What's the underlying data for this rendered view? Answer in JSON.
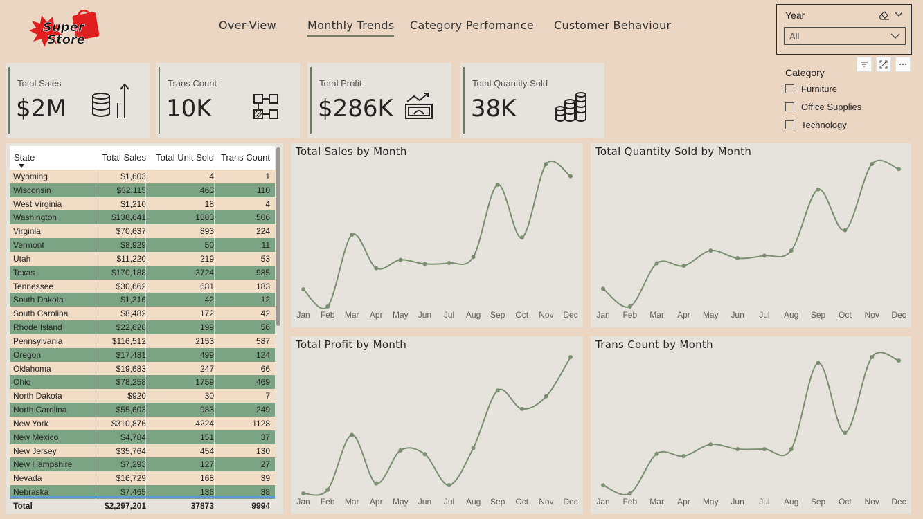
{
  "logo": {
    "line1": "Super",
    "line2": "Store"
  },
  "nav": {
    "tabs": [
      {
        "label": "Over-View"
      },
      {
        "label": "Monthly Trends",
        "active": true
      },
      {
        "label": "Category Perfomance"
      },
      {
        "label": "Customer Behaviour"
      }
    ]
  },
  "year_slicer": {
    "title": "Year",
    "selected": "All"
  },
  "kpis": [
    {
      "label": "Total Sales",
      "value": "$2M",
      "icon": "database-growth-icon"
    },
    {
      "label": "Trans Count",
      "value": "10K",
      "icon": "flowchart-icon"
    },
    {
      "label": "Total Profit",
      "value": "$286K",
      "icon": "profit-chart-icon"
    },
    {
      "label": "Total Quantity Sold",
      "value": "38K",
      "icon": "coin-stacks-icon"
    }
  ],
  "category_slicer": {
    "title": "Category",
    "items": [
      {
        "label": "Furniture",
        "checked": false
      },
      {
        "label": "Office Supplies",
        "checked": false
      },
      {
        "label": "Technology",
        "checked": false
      }
    ]
  },
  "table": {
    "headers": [
      "State",
      "Total Sales",
      "Total Unit Sold",
      "Trans Count"
    ],
    "rows": [
      [
        "Wyoming",
        "$1,603",
        "4",
        "1"
      ],
      [
        "Wisconsin",
        "$32,115",
        "463",
        "110"
      ],
      [
        "West Virginia",
        "$1,210",
        "18",
        "4"
      ],
      [
        "Washington",
        "$138,641",
        "1883",
        "506"
      ],
      [
        "Virginia",
        "$70,637",
        "893",
        "224"
      ],
      [
        "Vermont",
        "$8,929",
        "50",
        "11"
      ],
      [
        "Utah",
        "$11,220",
        "219",
        "53"
      ],
      [
        "Texas",
        "$170,188",
        "3724",
        "985"
      ],
      [
        "Tennessee",
        "$30,662",
        "681",
        "183"
      ],
      [
        "South Dakota",
        "$1,316",
        "42",
        "12"
      ],
      [
        "South Carolina",
        "$8,482",
        "172",
        "42"
      ],
      [
        "Rhode Island",
        "$22,628",
        "199",
        "56"
      ],
      [
        "Pennsylvania",
        "$116,512",
        "2153",
        "587"
      ],
      [
        "Oregon",
        "$17,431",
        "499",
        "124"
      ],
      [
        "Oklahoma",
        "$19,683",
        "247",
        "66"
      ],
      [
        "Ohio",
        "$78,258",
        "1759",
        "469"
      ],
      [
        "North Dakota",
        "$920",
        "30",
        "7"
      ],
      [
        "North Carolina",
        "$55,603",
        "983",
        "249"
      ],
      [
        "New York",
        "$310,876",
        "4224",
        "1128"
      ],
      [
        "New Mexico",
        "$4,784",
        "151",
        "37"
      ],
      [
        "New Jersey",
        "$35,764",
        "454",
        "130"
      ],
      [
        "New Hampshire",
        "$7,293",
        "127",
        "27"
      ],
      [
        "Nevada",
        "$16,729",
        "168",
        "39"
      ],
      [
        "Nebraska",
        "$7,465",
        "136",
        "38"
      ]
    ],
    "total": [
      "Total",
      "$2,297,201",
      "37873",
      "9994"
    ]
  },
  "colors": {
    "line": "#7a8e70",
    "row_green": "#7aa483",
    "row_beige": "#f1dcc6",
    "accent": "#6b7e62"
  },
  "chart_data": [
    {
      "type": "line",
      "title": "Total Sales by Month",
      "categories": [
        "Jan",
        "Feb",
        "Mar",
        "Apr",
        "May",
        "Jun",
        "Jul",
        "Aug",
        "Sep",
        "Oct",
        "Nov",
        "Dec"
      ],
      "values": [
        94900,
        59800,
        206000,
        138100,
        154900,
        146600,
        148600,
        161100,
        308000,
        200300,
        350200,
        325300
      ]
    },
    {
      "type": "line",
      "title": "Total Quantity Sold by Month",
      "categories": [
        "Jan",
        "Feb",
        "Mar",
        "Apr",
        "May",
        "Jun",
        "Jul",
        "Aug",
        "Sep",
        "Oct",
        "Nov",
        "Dec"
      ],
      "values": [
        1800,
        1100,
        2800,
        2700,
        3300,
        3000,
        3100,
        3300,
        5700,
        4100,
        6700,
        6500
      ]
    },
    {
      "type": "line",
      "title": "Total Profit by Month",
      "categories": [
        "Jan",
        "Feb",
        "Mar",
        "Apr",
        "May",
        "Jun",
        "Jul",
        "Aug",
        "Sep",
        "Oct",
        "Nov",
        "Dec"
      ],
      "values": [
        9100,
        10300,
        29100,
        12500,
        23800,
        22500,
        11900,
        24600,
        44300,
        38000,
        42300,
        55700
      ]
    },
    {
      "type": "line",
      "title": "Trans Count by Month",
      "categories": [
        "Jan",
        "Feb",
        "Mar",
        "Apr",
        "May",
        "Jun",
        "Jul",
        "Aug",
        "Sep",
        "Oct",
        "Nov",
        "Dec"
      ],
      "values": [
        430,
        360,
        700,
        680,
        780,
        740,
        740,
        740,
        1480,
        880,
        1530,
        1500
      ]
    }
  ]
}
